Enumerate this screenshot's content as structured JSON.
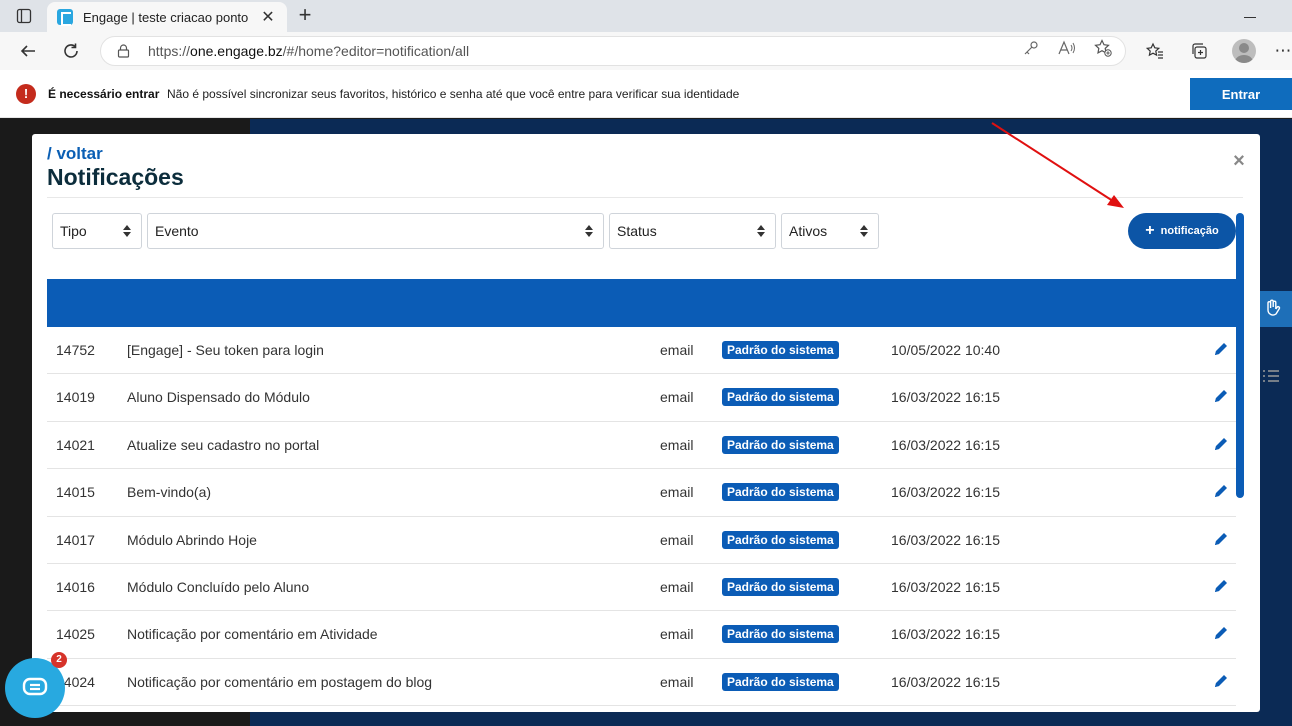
{
  "browser": {
    "tab_title": "Engage | teste criacao ponto",
    "url_prefix": "https://",
    "url_host": "one.engage.bz",
    "url_path": "/#/home?editor=notification/all",
    "close_tab_glyph": "✕",
    "new_tab_glyph": "+",
    "more_glyph": "⋯"
  },
  "sync_bar": {
    "icon": "!",
    "title": "É necessário entrar",
    "message": "Não é possível sincronizar seus favoritos, histórico e senha até que você entre para verificar sua identidade",
    "button_label": "Entrar"
  },
  "modal": {
    "back_label": "/ voltar",
    "title": "Notificações",
    "close_glyph": "×",
    "filters": {
      "tipo": "Tipo",
      "evento": "Evento",
      "status": "Status",
      "ativos": "Ativos"
    },
    "add_button": {
      "plus": "+",
      "label": "notificação"
    },
    "rows": [
      {
        "id": "14752",
        "name": "[Engage] - Seu token para login",
        "channel": "email",
        "badge": "Padrão do sistema",
        "date": "10/05/2022 10:40"
      },
      {
        "id": "14019",
        "name": "Aluno Dispensado do Módulo",
        "channel": "email",
        "badge": "Padrão do sistema",
        "date": "16/03/2022 16:15"
      },
      {
        "id": "14021",
        "name": "Atualize seu cadastro no portal",
        "channel": "email",
        "badge": "Padrão do sistema",
        "date": "16/03/2022 16:15"
      },
      {
        "id": "14015",
        "name": "Bem-vindo(a)",
        "channel": "email",
        "badge": "Padrão do sistema",
        "date": "16/03/2022 16:15"
      },
      {
        "id": "14017",
        "name": "Módulo Abrindo Hoje",
        "channel": "email",
        "badge": "Padrão do sistema",
        "date": "16/03/2022 16:15"
      },
      {
        "id": "14016",
        "name": "Módulo Concluído pelo Aluno",
        "channel": "email",
        "badge": "Padrão do sistema",
        "date": "16/03/2022 16:15"
      },
      {
        "id": "14025",
        "name": "Notificação por comentário em Atividade",
        "channel": "email",
        "badge": "Padrão do sistema",
        "date": "16/03/2022 16:15"
      },
      {
        "id": "14024",
        "name": "Notificação por comentário em postagem do blog",
        "channel": "email",
        "badge": "Padrão do sistema",
        "date": "16/03/2022 16:15"
      }
    ]
  },
  "chat": {
    "badge_count": "2"
  },
  "colors": {
    "brand_blue": "#0b5cb6",
    "annotation_arrow": "#e01010"
  }
}
